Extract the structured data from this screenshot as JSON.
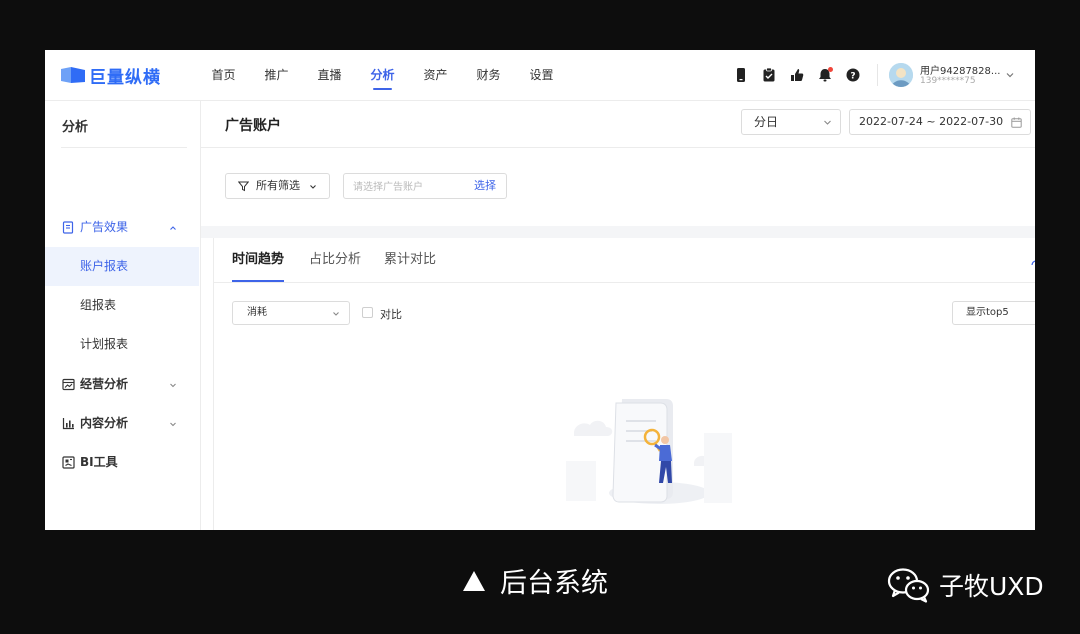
{
  "app": {
    "logo_text": "巨量纵横"
  },
  "nav": {
    "items": [
      "首页",
      "推广",
      "直播",
      "分析",
      "资产",
      "财务",
      "设置"
    ],
    "active": "分析",
    "icons": [
      "phone-icon",
      "clipboard-icon",
      "hand-thumb-icon",
      "bell-icon",
      "help-icon"
    ]
  },
  "user": {
    "name": "用户94287828...",
    "phone": "139******75"
  },
  "sidebar": {
    "title": "分析",
    "groups": [
      {
        "label": "广告效果",
        "icon": "document-icon",
        "expanded": true
      },
      {
        "label": "经营分析",
        "icon": "chart-board-icon",
        "expanded": false
      },
      {
        "label": "内容分析",
        "icon": "bar-chart-icon",
        "expanded": false
      },
      {
        "label": "BI工具",
        "icon": "bi-tool-icon"
      }
    ],
    "sub_items": [
      "账户报表",
      "组报表",
      "计划报表"
    ],
    "active_sub": "账户报表"
  },
  "page": {
    "title": "广告账户",
    "granularity": "分日",
    "date_range": "2022-07-24 ~ 2022-07-30"
  },
  "filter": {
    "all_filters": "所有筛选",
    "account_placeholder": "请选择广告账户",
    "choose": "选择"
  },
  "tabs": [
    "时间趋势",
    "占比分析",
    "累计对比"
  ],
  "controls": {
    "metric": "消耗",
    "compare": "对比",
    "top_n": "显示top5"
  },
  "caption": "后台系统",
  "brand": "子牧UXD",
  "colors": {
    "accent": "#3e64e8",
    "notification": "#f0463b",
    "background": "#0d0d0d"
  }
}
